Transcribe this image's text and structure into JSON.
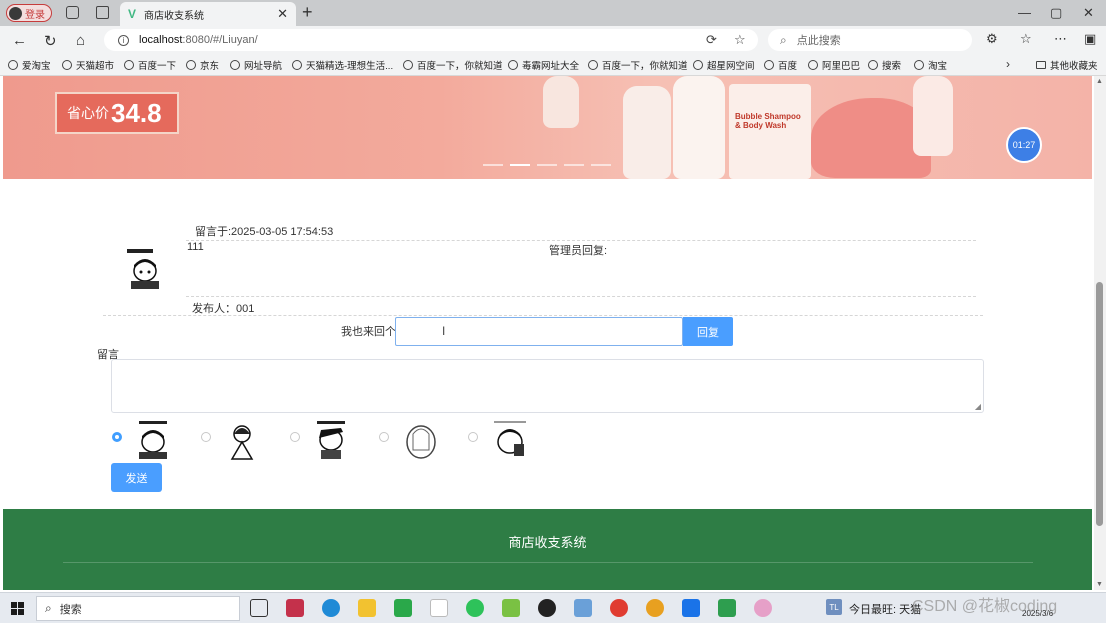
{
  "browser": {
    "profile_label": "登录",
    "tab_title": "商店收支系统",
    "url_host": "localhost",
    "url_path": ":8080/#/Liuyan/",
    "search_placeholder": "点此搜索",
    "bookmarks": [
      "爱淘宝",
      "天猫超市",
      "百度一下",
      "京东",
      "网址导航",
      "天猫精选-理想生活...",
      "百度一下，你就知道",
      "毒霸网址大全",
      "百度一下，你就知道",
      "超星网空间",
      "百度",
      "阿里巴巴",
      "搜索",
      "淘宝"
    ],
    "other_bookmarks": "其他收藏夹"
  },
  "banner": {
    "price_label": "省心价",
    "price_value": "34.8",
    "product_text": "Bubble Shampoo & Body Wash",
    "timer": "01:27"
  },
  "message": {
    "time": "留言于:2025-03-05 17:54:53",
    "content": "111",
    "admin_reply_label": "管理员回复:",
    "poster": "发布人：001",
    "reply_label": "我也来回个",
    "reply_button": "回复"
  },
  "form": {
    "label": "留言",
    "send_button": "发送",
    "emoji_count_selected": 0
  },
  "footer": {
    "title": "商店收支系统"
  },
  "taskbar": {
    "search_label": "搜索",
    "tray_text": "今日最旺: 天猫",
    "clock_date": "2025/3/6",
    "watermark": "CSDN @花椒coding"
  }
}
